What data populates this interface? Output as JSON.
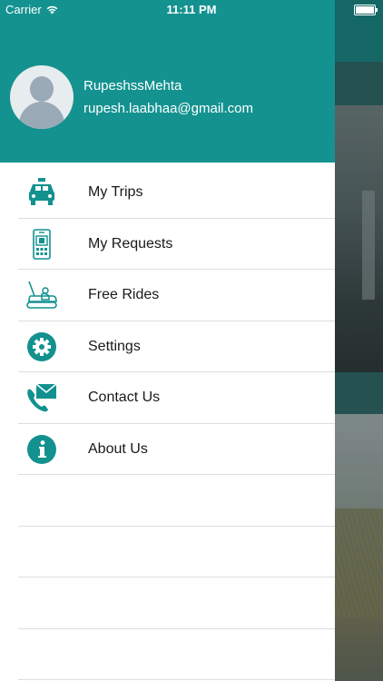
{
  "status_bar": {
    "carrier": "Carrier",
    "time": "11:11 PM"
  },
  "user": {
    "name": "RupeshssMehta",
    "email": "rupesh.laabhaa@gmail.com"
  },
  "menu": [
    {
      "label": "My Trips",
      "icon": "taxi-icon"
    },
    {
      "label": "My Requests",
      "icon": "mobile-app-icon"
    },
    {
      "label": "Free Rides",
      "icon": "bumper-car-icon"
    },
    {
      "label": "Settings",
      "icon": "gear-icon"
    },
    {
      "label": "Contact Us",
      "icon": "phone-mail-icon"
    },
    {
      "label": "About Us",
      "icon": "info-icon"
    }
  ],
  "colors": {
    "accent": "#149290",
    "icon": "#12918f"
  }
}
